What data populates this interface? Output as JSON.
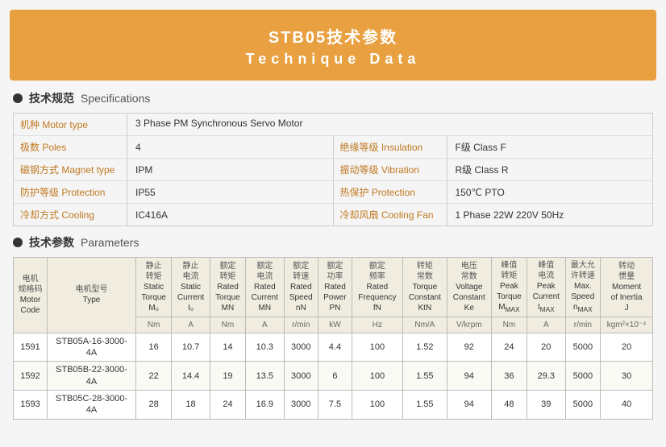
{
  "header": {
    "title_cn": "STB05技术参数",
    "title_en": "Technique  Data"
  },
  "specs_section": {
    "heading_cn": "技术规范",
    "heading_en": "Specifications",
    "rows": [
      {
        "left_label": "机种 Motor type",
        "left_value": "3 Phase PM Synchronous Servo Motor",
        "right_label": "",
        "right_value": ""
      },
      {
        "left_label": "极数 Poles",
        "left_value": "4",
        "right_label": "绝缘等级 Insulation",
        "right_value": "F级  Class F"
      },
      {
        "left_label": "磁钢方式 Magnet type",
        "left_value": "IPM",
        "right_label": "振动等级 Vibration",
        "right_value": "R级  Class R"
      },
      {
        "left_label": "防护等级 Protection",
        "left_value": "IP55",
        "right_label": "热保护 Protection",
        "right_value": "150℃ PTO"
      },
      {
        "left_label": "冷却方式 Cooling",
        "left_value": "IC416A",
        "right_label": "冷却风扇 Cooling Fan",
        "right_value": "1 Phase  22W  220V  50Hz"
      }
    ]
  },
  "params_section": {
    "heading_cn": "技术参数",
    "heading_en": "Parameters",
    "columns": [
      {
        "cn": "电机\n规格码",
        "en": "Motor\nCode",
        "sym": "",
        "unit": ""
      },
      {
        "cn": "电机型号",
        "en": "Type",
        "sym": "",
        "unit": ""
      },
      {
        "cn": "静止\n转矩",
        "en": "Static\nTorque",
        "sym": "M₀",
        "unit": "Nm"
      },
      {
        "cn": "静止\n电流",
        "en": "Static\nCurrent",
        "sym": "I₀",
        "unit": "A"
      },
      {
        "cn": "额定\n转矩",
        "en": "Rated\nTorque",
        "sym": "MN",
        "unit": "Nm"
      },
      {
        "cn": "额定\n电流",
        "en": "Rated\nCurrent",
        "sym": "MN",
        "unit": "A"
      },
      {
        "cn": "额定\n转速",
        "en": "Rated\nSpeed",
        "sym": "nN",
        "unit": "r/min"
      },
      {
        "cn": "额定\n功率",
        "en": "Rated\nPower",
        "sym": "PN",
        "unit": "kW"
      },
      {
        "cn": "额定\n频率",
        "en": "Rated\nFrequency",
        "sym": "fN",
        "unit": "Hz"
      },
      {
        "cn": "转矩\n常数",
        "en": "Torque\nConstant",
        "sym": "KtN",
        "unit": "Nm/A"
      },
      {
        "cn": "电压\n常数",
        "en": "Voltage\nConstant",
        "sym": "Ke",
        "unit": "V/krpm"
      },
      {
        "cn": "峰值\n转矩",
        "en": "Peak\nTorque",
        "sym": "MMAX",
        "unit": "Nm"
      },
      {
        "cn": "峰值\n电流",
        "en": "Peak\nCurrent",
        "sym": "IMAX",
        "unit": "A"
      },
      {
        "cn": "最大允\n许转速",
        "en": "Max.\nSpeed",
        "sym": "nMAX",
        "unit": "r/min"
      },
      {
        "cn": "转动\n惯量",
        "en": "Moment\nof Inertia",
        "sym": "J",
        "unit": "kgm²×10⁻⁴"
      }
    ],
    "rows": [
      {
        "code": "1591",
        "type": "STB05A-16-3000-4A",
        "m0": 16,
        "i0": 10.7,
        "mn_torque": 14,
        "mn_current": 10.3,
        "speed": 3000,
        "power": 4.4,
        "freq": 100,
        "kt": 1.52,
        "ke": 92,
        "peak_torque": 24,
        "peak_current": 20.0,
        "max_speed": 5000,
        "inertia": 20
      },
      {
        "code": "1592",
        "type": "STB05B-22-3000-4A",
        "m0": 22,
        "i0": 14.4,
        "mn_torque": 19,
        "mn_current": 13.5,
        "speed": 3000,
        "power": 6.0,
        "freq": 100,
        "kt": 1.55,
        "ke": 94,
        "peak_torque": 36,
        "peak_current": 29.3,
        "max_speed": 5000,
        "inertia": 30
      },
      {
        "code": "1593",
        "type": "STB05C-28-3000-4A",
        "m0": 28,
        "i0": 18.0,
        "mn_torque": 24,
        "mn_current": 16.9,
        "speed": 3000,
        "power": 7.5,
        "freq": 100,
        "kt": 1.55,
        "ke": 94,
        "peak_torque": 48,
        "peak_current": 39.0,
        "max_speed": 5000,
        "inertia": 40
      }
    ]
  }
}
